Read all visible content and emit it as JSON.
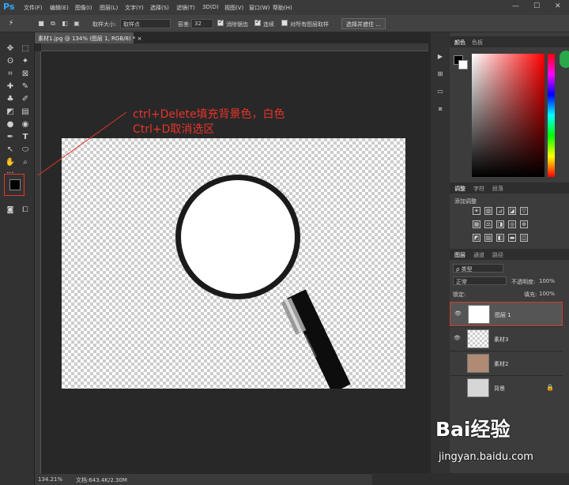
{
  "app": {
    "logo": "Ps"
  },
  "menu": [
    "文件(F)",
    "编辑(E)",
    "图像(I)",
    "图层(L)",
    "文字(Y)",
    "选择(S)",
    "滤镜(T)",
    "3D(D)",
    "视图(V)",
    "窗口(W)",
    "帮助(H)"
  ],
  "window_controls": [
    "—",
    "☐",
    "✕"
  ],
  "options": {
    "sample_size_label": "取样大小:",
    "sample_size_value": "取样点",
    "tolerance_label": "容差:",
    "tolerance_value": "32",
    "antialias_label": "消除锯齿",
    "contiguous_label": "连续",
    "all_layers_label": "对所有图层取样",
    "select_mask_button": "选择并遮住 ..."
  },
  "document": {
    "tab_title": "素材1.jpg @ 134% (图层 1, RGB/8) *  ×"
  },
  "annotation": {
    "line1": "ctrl+Delete填充背景色，白色",
    "line2": "Ctrl+D取消选区"
  },
  "status": {
    "zoom": "134.21%",
    "doc_info": "文档:643.4K/2.30M"
  },
  "color_panel": {
    "tabs": [
      "颜色",
      "色板"
    ]
  },
  "adjust_panel": {
    "tabs": [
      "调整",
      "字符",
      "段落"
    ],
    "title": "添加调整"
  },
  "layers_panel": {
    "tabs": [
      "图层",
      "通道",
      "路径"
    ],
    "filter_kind": "ρ 类型",
    "blend_mode": "正常",
    "opacity_label": "不透明度:",
    "opacity_value": "100%",
    "lock_label": "锁定:",
    "fill_label": "填充:",
    "fill_value": "100%",
    "layers": [
      {
        "name": "图层 1",
        "visible": true,
        "selected": true
      },
      {
        "name": "素材3",
        "visible": true,
        "selected": false
      },
      {
        "name": "素材2",
        "visible": false,
        "selected": false
      },
      {
        "name": "背景",
        "visible": false,
        "selected": false
      }
    ]
  },
  "watermark": {
    "brand": "Bai经验",
    "url": "jingyan.baidu.com"
  },
  "colors": {
    "accent_red": "#e8332a",
    "ps_blue": "#31a8ff"
  }
}
